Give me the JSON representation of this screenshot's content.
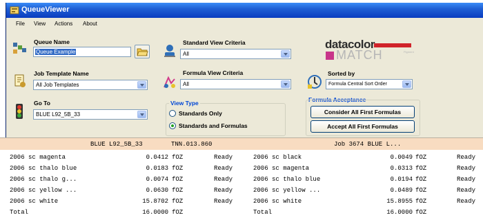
{
  "window": {
    "title": "QueueViewer"
  },
  "menu": [
    "File",
    "View",
    "Actions",
    "About"
  ],
  "queue_name": {
    "label": "Queue Name",
    "value": "Queue Example"
  },
  "job_template": {
    "label": "Job Template Name",
    "value": "All Job Templates"
  },
  "go_to": {
    "label": "Go To",
    "value": "BLUE L92_5B_33"
  },
  "standard_view": {
    "label": "Standard View Criteria",
    "value": "All"
  },
  "formula_view": {
    "label": "Formula View Criteria",
    "value": "All"
  },
  "view_type": {
    "title": "View Type",
    "options": [
      "Standards Only",
      "Standards and Formulas"
    ],
    "selected": "Standards and Formulas"
  },
  "sorted_by": {
    "label": "Sorted by",
    "value": "Formula Central Sort Order"
  },
  "formula_acceptance": {
    "title": "Formula Acceptance",
    "consider_label": "Consider All First Formulas",
    "accept_label": "Accept All First Formulas"
  },
  "logo": {
    "brand": "datacolor",
    "product": "MATCH",
    "tag": "Pigment"
  },
  "grid": {
    "header": {
      "standard": "BLUE L92_5B_33",
      "formula": "TNN.013.860",
      "job": "Job 3674 BLUE L..."
    },
    "left_rows": [
      {
        "name": "2006 sc magenta",
        "amount": "0.0412",
        "unit": "fOZ",
        "status": "Ready"
      },
      {
        "name": "2006 sc thalo blue",
        "amount": "0.0183",
        "unit": "fOZ",
        "status": "Ready"
      },
      {
        "name": "2006 sc thalo g...",
        "amount": "0.0074",
        "unit": "fOZ",
        "status": "Ready"
      },
      {
        "name": "2006 sc yellow ...",
        "amount": "0.0630",
        "unit": "fOZ",
        "status": "Ready"
      },
      {
        "name": "2006 sc white",
        "amount": "15.8702",
        "unit": "fOZ",
        "status": "Ready"
      }
    ],
    "left_total": {
      "name": "Total",
      "amount": "16.0000",
      "unit": "fOZ"
    },
    "right_rows": [
      {
        "name": "2006 sc black",
        "amount": "0.0049",
        "unit": "fOZ",
        "status": "Ready"
      },
      {
        "name": "2006 sc magenta",
        "amount": "0.0313",
        "unit": "fOZ",
        "status": "Ready"
      },
      {
        "name": "2006 sc thalo blue",
        "amount": "0.0194",
        "unit": "fOZ",
        "status": "Ready"
      },
      {
        "name": "2006 sc yellow ...",
        "amount": "0.0489",
        "unit": "fOZ",
        "status": "Ready"
      },
      {
        "name": "2006 sc white",
        "amount": "15.8955",
        "unit": "fOZ",
        "status": "Ready"
      }
    ],
    "right_total": {
      "name": "Total",
      "amount": "16.0000",
      "unit": "fOZ"
    }
  },
  "colors": {
    "titlebar": "#1f5fd4",
    "header_row": "#f8dcc1",
    "panel": "#ece9d8"
  }
}
